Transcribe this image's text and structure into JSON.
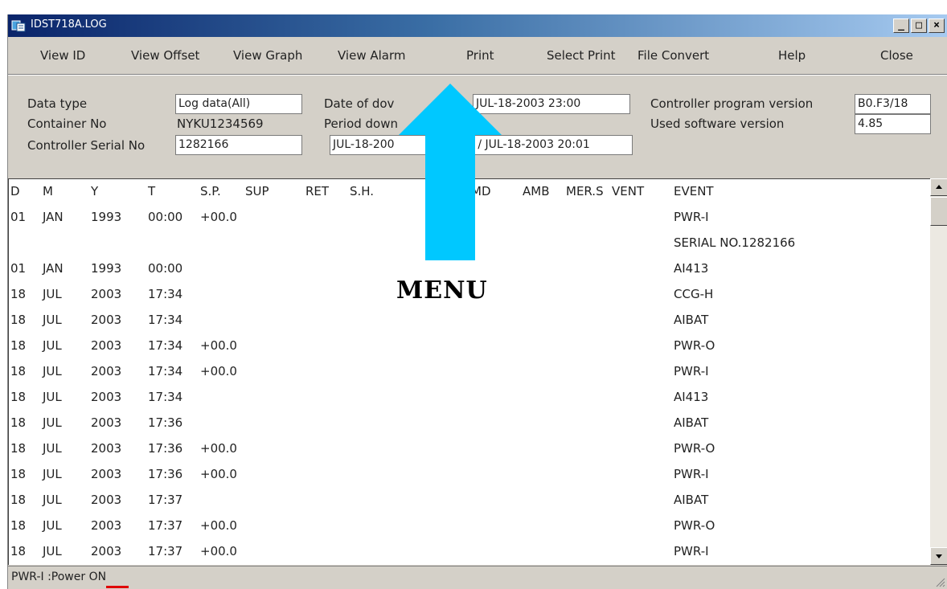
{
  "window": {
    "title": "IDST718A.LOG",
    "buttons": {
      "minimize": "_",
      "maximize": "□",
      "close": "×"
    }
  },
  "menu": {
    "items": [
      {
        "id": "view-id",
        "label": "View ID"
      },
      {
        "id": "view-offset",
        "label": "View Offset"
      },
      {
        "id": "view-graph",
        "label": "View Graph"
      },
      {
        "id": "view-alarm",
        "label": "View Alarm"
      },
      {
        "id": "print",
        "label": "Print"
      },
      {
        "id": "select-print",
        "label": "Select Print"
      },
      {
        "id": "file-convert",
        "label": "File Convert"
      },
      {
        "id": "help",
        "label": "Help"
      },
      {
        "id": "close",
        "label": "Close"
      }
    ]
  },
  "info": {
    "data_type_label": "Data type",
    "data_type_value": "Log data(All)",
    "container_no_label": "Container No",
    "container_no_value": "NYKU1234569",
    "controller_serial_label": "Controller Serial No",
    "controller_serial_value": "1282166",
    "date_download_label": "Date of dov",
    "date_download_value": "JUL-18-2003 23:00",
    "period_download_label": "Period down",
    "period_download_value_left": "JUL-18-200",
    "period_download_value_right": "2 / JUL-18-2003 20:01",
    "program_version_label": "Controller program version",
    "program_version_value": "B0.F3/18",
    "software_version_label": "Used software version",
    "software_version_value": "4.85"
  },
  "table": {
    "headers": [
      "D",
      "M",
      "Y",
      "T",
      "S.P.",
      "SUP",
      "RET",
      "S.H.",
      "MD",
      "AMB",
      "MER.S",
      "VENT",
      "EVENT"
    ],
    "rows": [
      {
        "D": "01",
        "M": "JAN",
        "Y": "1993",
        "T": "00:00",
        "SP": "+00.0",
        "EVENT": "PWR-I"
      },
      {
        "D": "",
        "M": "",
        "Y": "",
        "T": "",
        "SP": "",
        "EVENT": "SERIAL NO.1282166"
      },
      {
        "D": "01",
        "M": "JAN",
        "Y": "1993",
        "T": "00:00",
        "SP": "",
        "EVENT": "AI413"
      },
      {
        "D": "18",
        "M": "JUL",
        "Y": "2003",
        "T": "17:34",
        "SP": "",
        "EVENT": "CCG-H"
      },
      {
        "D": "18",
        "M": "JUL",
        "Y": "2003",
        "T": "17:34",
        "SP": "",
        "EVENT": "AIBAT"
      },
      {
        "D": "18",
        "M": "JUL",
        "Y": "2003",
        "T": "17:34",
        "SP": "+00.0",
        "EVENT": "PWR-O"
      },
      {
        "D": "18",
        "M": "JUL",
        "Y": "2003",
        "T": "17:34",
        "SP": "+00.0",
        "EVENT": "PWR-I"
      },
      {
        "D": "18",
        "M": "JUL",
        "Y": "2003",
        "T": "17:34",
        "SP": "",
        "EVENT": "AI413"
      },
      {
        "D": "18",
        "M": "JUL",
        "Y": "2003",
        "T": "17:36",
        "SP": "",
        "EVENT": "AIBAT"
      },
      {
        "D": "18",
        "M": "JUL",
        "Y": "2003",
        "T": "17:36",
        "SP": "+00.0",
        "EVENT": "PWR-O"
      },
      {
        "D": "18",
        "M": "JUL",
        "Y": "2003",
        "T": "17:36",
        "SP": "+00.0",
        "EVENT": "PWR-I"
      },
      {
        "D": "18",
        "M": "JUL",
        "Y": "2003",
        "T": "17:37",
        "SP": "",
        "EVENT": "AIBAT"
      },
      {
        "D": "18",
        "M": "JUL",
        "Y": "2003",
        "T": "17:37",
        "SP": "+00.0",
        "EVENT": "PWR-O"
      },
      {
        "D": "18",
        "M": "JUL",
        "Y": "2003",
        "T": "17:37",
        "SP": "+00.0",
        "EVENT": "PWR-I"
      }
    ]
  },
  "status": {
    "text": "PWR-I :Power ON"
  },
  "annotation": {
    "label": "MENU",
    "arrow_color": "#00c8ff",
    "underline_color": "#e00000"
  },
  "colors": {
    "title_bar": "#0a246a",
    "chrome": "#d4d0c8"
  }
}
